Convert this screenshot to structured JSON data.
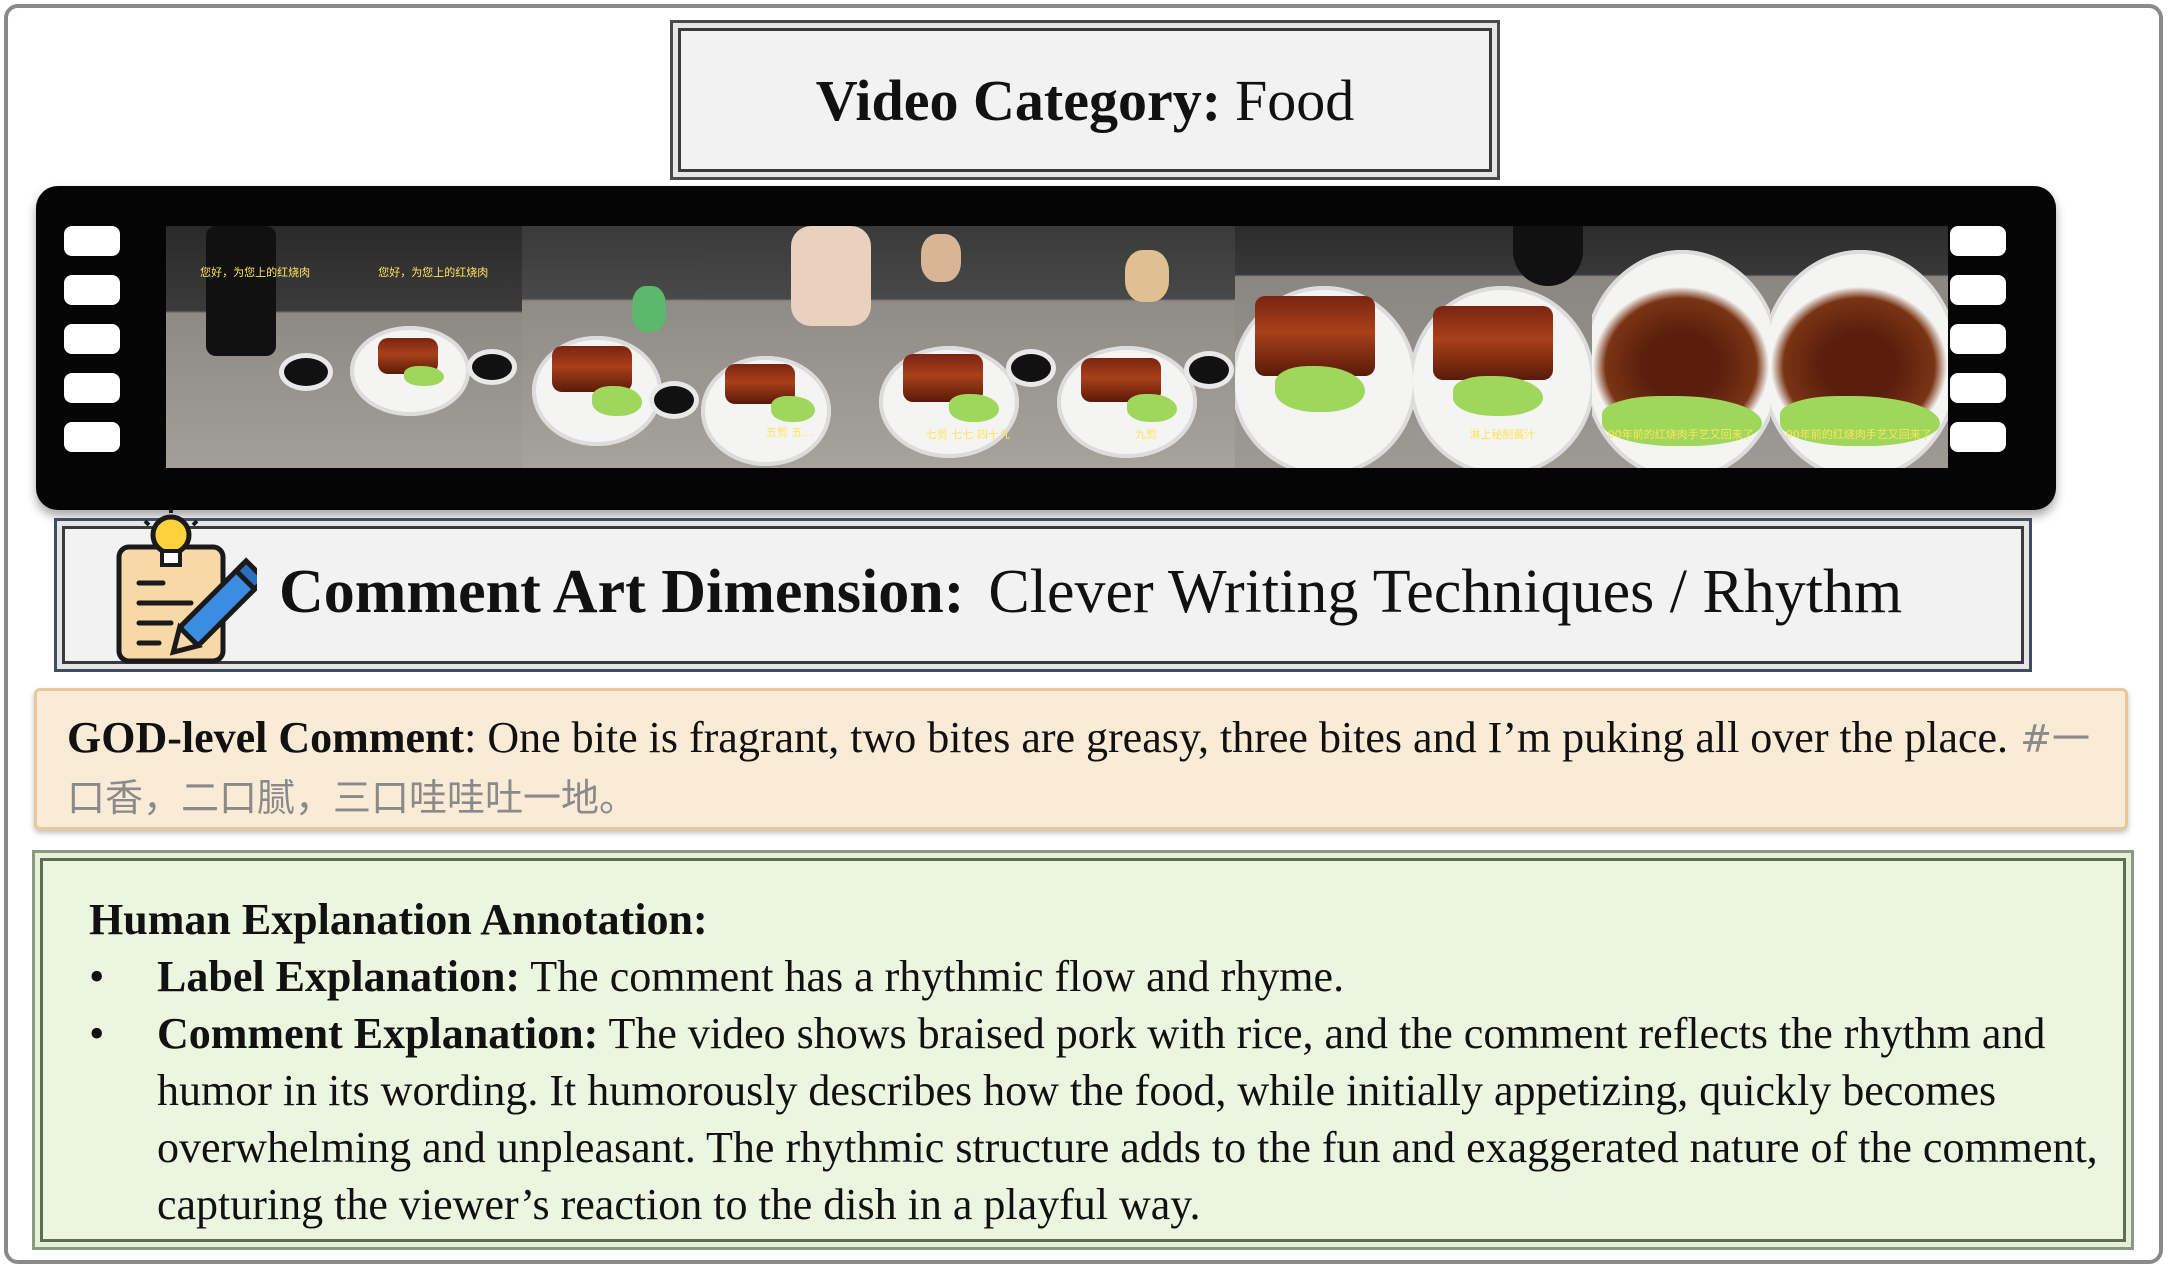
{
  "category": {
    "label": "Video Category:",
    "value": "Food"
  },
  "film": {
    "frames": [
      {
        "subtitle": "您好，为您上的红烧肉"
      },
      {
        "subtitle": "您好，为您上的红烧肉"
      },
      {
        "subtitle": ""
      },
      {
        "subtitle": "五剪 五…"
      },
      {
        "subtitle": "七剪 七七 四十九"
      },
      {
        "subtitle": "九剪"
      },
      {
        "subtitle": ""
      },
      {
        "subtitle": "淋上秘制酱汁"
      },
      {
        "subtitle": "00年前的红烧肉手艺又回来了"
      },
      {
        "subtitle": "00年前的红烧肉手艺又回来了"
      }
    ]
  },
  "art_dimension": {
    "label": "Comment Art Dimension:",
    "value": "Clever Writing Techniques / Rhythm",
    "icon": "notepad-pencil-lightbulb-icon"
  },
  "god_comment": {
    "label": "GOD-level Comment",
    "text": ": One bite is fragrant, two bites are greasy, three bites and I’m puking all over the place.",
    "original": " #一口香，二口腻，三口哇哇吐一地。"
  },
  "human": {
    "title": "Human Explanation Annotation:",
    "items": [
      {
        "label": "Label Explanation:",
        "text": " The comment has a rhythmic flow and rhyme."
      },
      {
        "label": "Comment Explanation:",
        "text": " The video shows braised pork with rice, and the comment reflects the rhythm and humor in its wording. It humorously describes how the food, while initially appetizing, quickly becomes overwhelming and unpleasant. The rhythmic structure adds to the fun and exaggerated nature of the comment, capturing the viewer’s reaction to the dish in a playful way."
      }
    ],
    "bullet": "•"
  }
}
